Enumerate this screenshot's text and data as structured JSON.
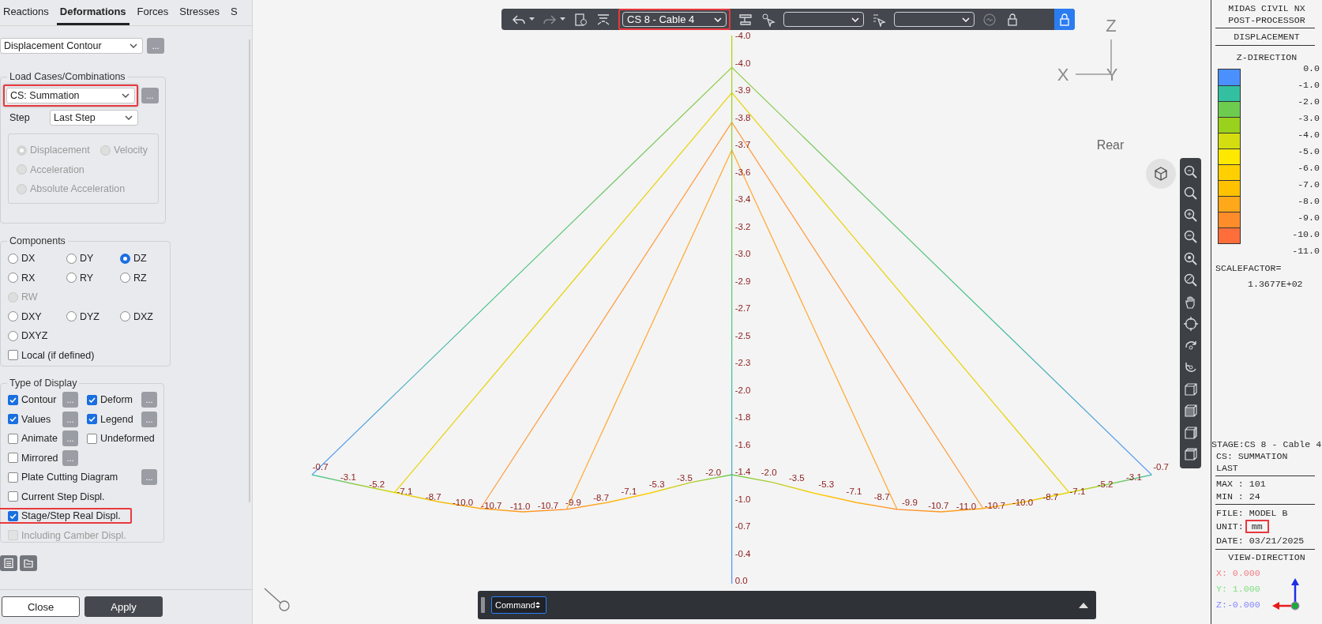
{
  "panel": {
    "tabs": [
      {
        "label": "Reactions",
        "selected": false
      },
      {
        "label": "Deformations",
        "selected": true
      },
      {
        "label": "Forces",
        "selected": false
      },
      {
        "label": "Stresses",
        "selected": false
      },
      {
        "label": "S",
        "selected": false
      }
    ],
    "result_type": {
      "value": "Displacement Contour",
      "more": "..."
    },
    "load_cases": {
      "title": "Load Cases/Combinations",
      "case": {
        "value": "CS: Summation",
        "highlighted": true
      },
      "more": "...",
      "step_label": "Step",
      "step": {
        "value": "Last Step"
      },
      "modes": [
        {
          "kind": "half",
          "label": "Displacement",
          "selected": true,
          "disabled": true
        },
        {
          "kind": "half",
          "label": "Velocity",
          "selected": false,
          "disabled": true
        },
        {
          "kind": "wide",
          "label": "Acceleration",
          "selected": false,
          "disabled": true
        },
        {
          "kind": "wide",
          "label": "Absolute Acceleration",
          "selected": false,
          "disabled": true
        }
      ]
    },
    "components": {
      "title": "Components",
      "options": [
        {
          "kind": "cell",
          "label": "DX",
          "selected": false,
          "disabled": false
        },
        {
          "kind": "cell",
          "label": "DY",
          "selected": false,
          "disabled": false
        },
        {
          "kind": "cell",
          "label": "DZ",
          "selected": true,
          "disabled": false
        },
        {
          "kind": "cell",
          "label": "RX",
          "selected": false,
          "disabled": false
        },
        {
          "kind": "cell",
          "label": "RY",
          "selected": false,
          "disabled": false
        },
        {
          "kind": "cell",
          "label": "RZ",
          "selected": false,
          "disabled": false
        },
        {
          "kind": "wide",
          "label": "RW",
          "selected": false,
          "disabled": true
        },
        {
          "kind": "cell",
          "label": "DXY",
          "selected": false,
          "disabled": false
        },
        {
          "kind": "cell",
          "label": "DYZ",
          "selected": false,
          "disabled": false
        },
        {
          "kind": "cell",
          "label": "DXZ",
          "selected": false,
          "disabled": false
        },
        {
          "kind": "wide",
          "label": "DXYZ",
          "selected": false,
          "disabled": false
        }
      ],
      "local": {
        "label": "Local (if defined)",
        "checked": false
      }
    },
    "display": {
      "title": "Type of Display",
      "options": [
        {
          "kind": "half",
          "label": "Contour",
          "checked": true,
          "disabled": false,
          "highlighted": false,
          "more": "..."
        },
        {
          "kind": "half",
          "label": "Deform",
          "checked": true,
          "disabled": false,
          "highlighted": false,
          "more": "..."
        },
        {
          "kind": "half",
          "label": "Values",
          "checked": true,
          "disabled": false,
          "highlighted": false,
          "more": "..."
        },
        {
          "kind": "half",
          "label": "Legend",
          "checked": true,
          "disabled": false,
          "highlighted": false,
          "more": "..."
        },
        {
          "kind": "half",
          "label": "Animate",
          "checked": false,
          "disabled": false,
          "highlighted": false,
          "more": "..."
        },
        {
          "kind": "half",
          "label": "Undeformed",
          "checked": false,
          "disabled": false,
          "highlighted": false
        },
        {
          "kind": "half",
          "label": "Mirrored",
          "checked": false,
          "disabled": false,
          "highlighted": false,
          "more": "..."
        },
        {
          "kind": "wide",
          "label": "Plate Cutting Diagram",
          "checked": false,
          "disabled": false,
          "highlighted": false,
          "more": "..."
        },
        {
          "kind": "wide",
          "label": "Current Step Displ.",
          "checked": false,
          "disabled": false,
          "highlighted": false
        },
        {
          "kind": "wide",
          "label": "Stage/Step Real Displ.",
          "checked": true,
          "disabled": false,
          "highlighted": true
        },
        {
          "kind": "wide",
          "label": "Including Camber Displ.",
          "checked": false,
          "disabled": true,
          "highlighted": false
        }
      ]
    },
    "buttons": [
      {
        "kind": "secondary",
        "label": "Close"
      },
      {
        "kind": "primary",
        "label": "Apply"
      }
    ]
  },
  "viewport": {
    "stage_select": {
      "value": "CS 8 - Cable 4",
      "highlighted": true
    },
    "axes": {
      "vertical": "Z",
      "horizontal": "X",
      "depth": "Y"
    },
    "view_label": "Rear",
    "mast_labels": [
      "-4.0",
      "-4.0",
      "-3.9",
      "-3.8",
      "-3.7",
      "-3.6",
      "-3.4",
      "-3.2",
      "-3.0",
      "-2.9",
      "-2.7",
      "-2.5",
      "-2.3",
      "-2.0",
      "-1.8",
      "-1.6",
      "-1.4",
      "-1.0",
      "-0.7",
      "-0.4",
      "0.0"
    ],
    "deck_labels": [
      "-0.7",
      "-3.1",
      "-5.2",
      "-7.1",
      "-8.7",
      "-10.0",
      "-10.7",
      "-11.0",
      "-10.7",
      "-9.9",
      "-8.7",
      "-7.1",
      "-5.3",
      "-3.5",
      "-2.0",
      "-2.0",
      "-3.5",
      "-5.3",
      "-7.1",
      "-8.7",
      "-9.9",
      "-10.7",
      "-11.0",
      "-10.7",
      "-10.0",
      "-8.7",
      "-7.1",
      "-5.2",
      "-3.1",
      "-0.7"
    ],
    "command": {
      "placeholder": "Command"
    }
  },
  "legend": {
    "title_lines": [
      "MIDAS CIVIL NX",
      "POST-PROCESSOR"
    ],
    "result": "DISPLACEMENT",
    "direction": "Z-DIRECTION",
    "bands": [
      {
        "color": "#4a90ff"
      },
      {
        "color": "#33c0a0"
      },
      {
        "color": "#6dcc50"
      },
      {
        "color": "#99d11c"
      },
      {
        "color": "#d4dd10"
      },
      {
        "color": "#ffe800"
      },
      {
        "color": "#ffd000"
      },
      {
        "color": "#ffc200"
      },
      {
        "color": "#ffa81a"
      },
      {
        "color": "#ff8c2a"
      },
      {
        "color": "#ff6e3a"
      }
    ],
    "ticks": [
      "0.0",
      "-1.0",
      "-2.0",
      "-3.0",
      "-4.0",
      "-5.0",
      "-6.0",
      "-7.0",
      "-8.0",
      "-9.0",
      "-10.0",
      "-11.0"
    ],
    "scale_label": "SCALEFACTOR=",
    "scale_value": "1.3677E+02",
    "stage": "STAGE:CS 8 - Cable 4",
    "case": "CS: SUMMATION",
    "step": "LAST",
    "max": "MAX : 101",
    "min": "MIN : 24",
    "file": "FILE: MODEL B",
    "unit_label": "UNIT:",
    "unit": {
      "value": "mm",
      "highlighted": true
    },
    "date": "DATE: 03/21/2025",
    "view_title": "VIEW-DIRECTION",
    "view": [
      {
        "text": "X: 0.000",
        "color": "#f07f86"
      },
      {
        "text": "Y: 1.000",
        "color": "#7fe07f"
      },
      {
        "text": "Z:-0.000",
        "color": "#8585ff"
      }
    ]
  }
}
